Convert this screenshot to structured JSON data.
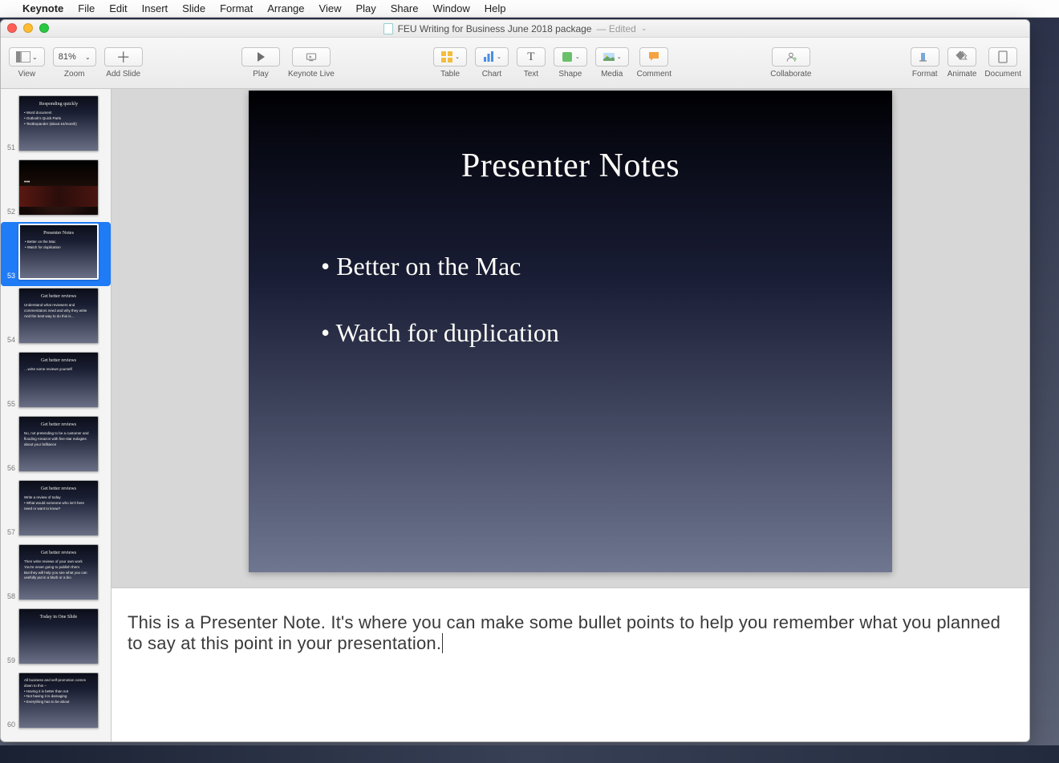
{
  "menubar": {
    "app": "Keynote",
    "items": [
      "File",
      "Edit",
      "Insert",
      "Slide",
      "Format",
      "Arrange",
      "View",
      "Play",
      "Share",
      "Window",
      "Help"
    ]
  },
  "window": {
    "title": "FEU Writing for Business June 2018 package",
    "status": "Edited"
  },
  "toolbar": {
    "view": "View",
    "zoom_value": "81%",
    "zoom": "Zoom",
    "add_slide": "Add Slide",
    "play": "Play",
    "keynote_live": "Keynote Live",
    "table": "Table",
    "chart": "Chart",
    "text": "Text",
    "shape": "Shape",
    "media": "Media",
    "comment": "Comment",
    "collaborate": "Collaborate",
    "format": "Format",
    "animate": "Animate",
    "document": "Document"
  },
  "slide": {
    "title": "Presenter Notes",
    "bullets": [
      "Better on the Mac",
      "Watch for duplication"
    ]
  },
  "notes_text": "This is a Presenter Note. It's where you can make some bullet points to help you remember what you planned to say at this point in your presentation",
  "thumbnails": [
    {
      "num": 51,
      "title": "Responding quickly",
      "lines": [
        "• Word document",
        "• Outlook's Quick Parts",
        "• TextExpander (about £4/month)"
      ]
    },
    {
      "num": 52,
      "photo": true
    },
    {
      "num": 53,
      "title": "Presenter Notes",
      "lines": [
        "• Better on the Mac",
        "• Watch for duplication"
      ],
      "selected": true
    },
    {
      "num": 54,
      "title": "Get better reviews",
      "lines": [
        "Understand what reviewers and commentators need and why they write",
        "And the best way to do this is…"
      ]
    },
    {
      "num": 55,
      "title": "Get better reviews",
      "lines": [
        "…write some reviews yourself"
      ]
    },
    {
      "num": 56,
      "title": "Get better reviews",
      "lines": [
        "No, not pretending to be a customer and flooding Amazon with five-star eulogies about your brilliance"
      ]
    },
    {
      "num": 57,
      "title": "Get better reviews",
      "lines": [
        "Write a review of today",
        "• What would someone who isn't here need or want to know?"
      ]
    },
    {
      "num": 58,
      "title": "Get better reviews",
      "lines": [
        "Then write reviews of your own work",
        "You're never going to publish them",
        "But they will help you see what you can usefully put in a blurb or a bio"
      ]
    },
    {
      "num": 59,
      "title": "Today in One Slide",
      "lines": []
    },
    {
      "num": 60,
      "title": "",
      "lines": [
        "All business and self-promotion comes down to this –",
        "• Having it is better than not",
        "• Not having it is damaging",
        "• Everything has to be about"
      ]
    }
  ]
}
